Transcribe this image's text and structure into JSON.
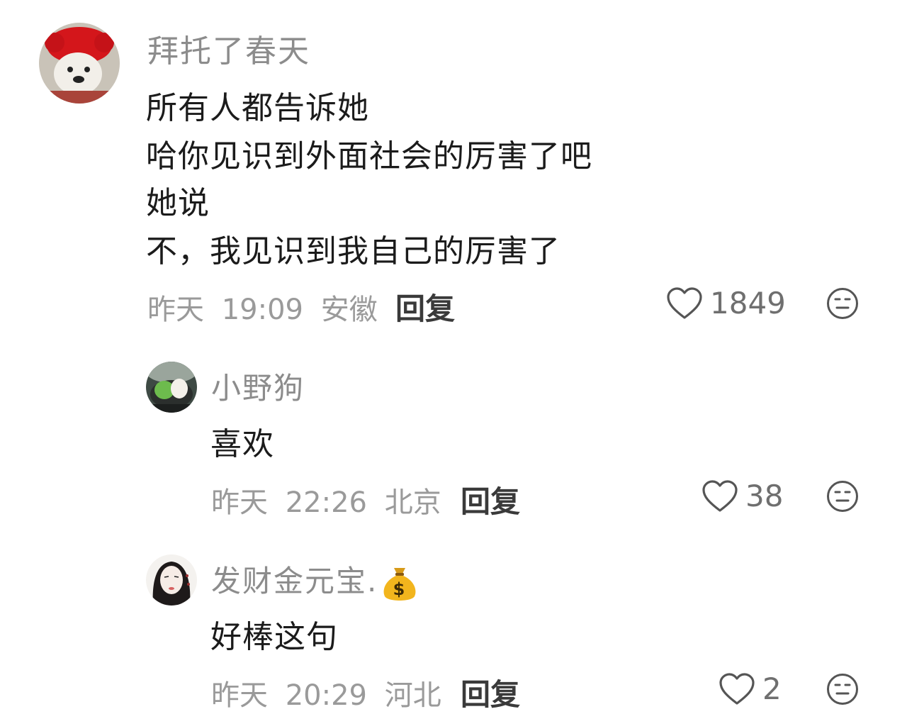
{
  "comments": [
    {
      "username": "拜托了春天",
      "content": [
        "所有人都告诉她",
        "哈你见识到外面社会的厉害了吧",
        "她说",
        "不，我见识到我自己的厉害了"
      ],
      "date": "昨天",
      "time": "19:09",
      "location": "安徽",
      "reply_label": "回复",
      "likes": "1849",
      "avatar": "red-hat-bear-avatar"
    },
    {
      "username": "小野狗",
      "content": [
        "喜欢"
      ],
      "date": "昨天",
      "time": "22:26",
      "location": "北京",
      "reply_label": "回复",
      "likes": "38",
      "avatar": "green-dessert-avatar"
    },
    {
      "username": "发财金元宝.",
      "username_emoji": "money-bag-icon",
      "content": [
        "好棒这句"
      ],
      "date": "昨天",
      "time": "20:29",
      "location": "河北",
      "reply_label": "回复",
      "likes": "2",
      "avatar": "sketch-girl-avatar"
    }
  ],
  "icons": {
    "like": "heart-outline-icon",
    "emoji": "neutral-face-icon"
  },
  "colors": {
    "username": "#8c8c8c",
    "content": "#1b1b1b",
    "meta": "#9a9a9a",
    "reply": "#3a3a3a",
    "icon": "#555555"
  }
}
